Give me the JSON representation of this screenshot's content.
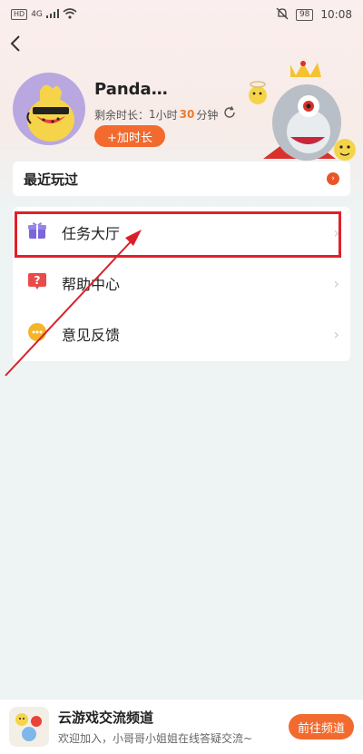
{
  "status_bar": {
    "hd": "HD",
    "signal": "4G",
    "battery": "98",
    "time": "10:08"
  },
  "profile": {
    "username": "Panda…",
    "remain_label": "剩余时长：",
    "hours": "1",
    "hours_unit": "小时",
    "minutes": "30",
    "minutes_unit": "分钟",
    "add_time_label": "+加时长"
  },
  "recent": {
    "title": "最近玩过"
  },
  "menu": {
    "items": [
      {
        "label": "任务大厅",
        "icon": "gift-icon"
      },
      {
        "label": "帮助中心",
        "icon": "question-icon"
      },
      {
        "label": "意见反馈",
        "icon": "chat-icon"
      }
    ]
  },
  "banner": {
    "title": "云游戏交流频道",
    "subtitle": "欢迎加入，小哥哥小姐姐在线答疑交流~",
    "button_label": "前往频道"
  },
  "colors": {
    "accent": "#f26a2e",
    "highlight": "#e0202a"
  }
}
